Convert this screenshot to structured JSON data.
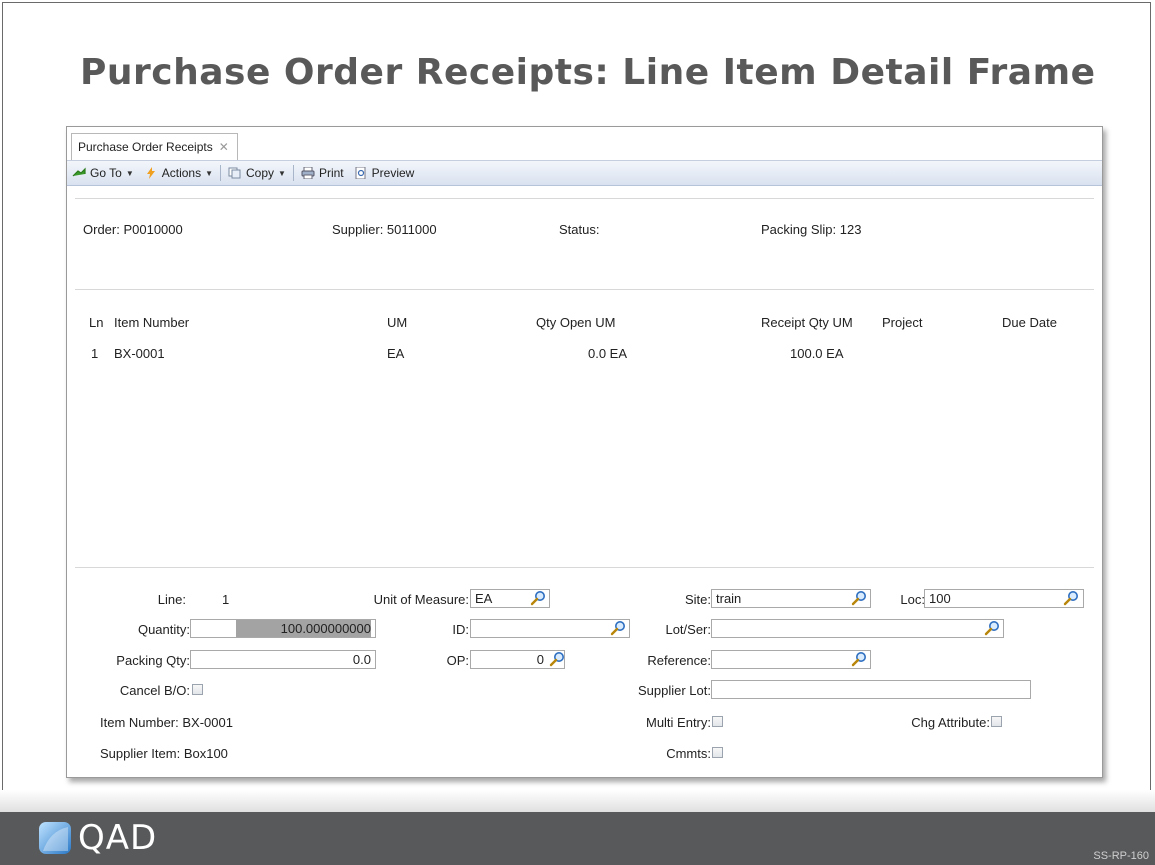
{
  "slide": {
    "title": "Purchase Order Receipts: Line Item Detail Frame",
    "code": "SS-RP-160"
  },
  "brand": {
    "name": "QAD",
    "bar_color": "#58595b"
  },
  "window": {
    "tab_label": "Purchase Order Receipts",
    "toolbar": {
      "goto": "Go To",
      "actions": "Actions",
      "copy": "Copy",
      "print": "Print",
      "preview": "Preview"
    }
  },
  "header": {
    "order": "Order: P0010000",
    "supplier": "Supplier: 5011000",
    "status": "Status:",
    "packing_slip": "Packing Slip: 123"
  },
  "lines": {
    "columns": [
      "Ln",
      "Item Number",
      "UM",
      "Qty Open UM",
      "Receipt Qty UM",
      "Project",
      "Due Date"
    ],
    "rows": [
      {
        "ln": "1",
        "item": "BX-0001",
        "um": "EA",
        "qty_open": "0.0 EA",
        "receipt_qty": "100.0 EA"
      }
    ]
  },
  "detail": {
    "line_label": "Line:",
    "line_value": "1",
    "uom_label": "Unit of Measure:",
    "uom_value": "EA",
    "site_label": "Site:",
    "site_value": "train",
    "loc_label": "Loc:",
    "loc_value": "100",
    "quantity_label": "Quantity:",
    "quantity_value": "100.000000000",
    "id_label": "ID:",
    "id_value": "",
    "lotser_label": "Lot/Ser:",
    "lotser_value": "",
    "packing_qty_label": "Packing Qty:",
    "packing_qty_value": "0.0",
    "op_label": "OP:",
    "op_value": "0",
    "reference_label": "Reference:",
    "reference_value": "",
    "cancel_bo_label": "Cancel B/O:",
    "supplier_lot_label": "Supplier Lot:",
    "supplier_lot_value": "",
    "item_number": "Item Number:  BX-0001",
    "multi_entry_label": "Multi Entry:",
    "chg_attribute_label": "Chg Attribute:",
    "supplier_item": "Supplier Item:  Box100",
    "cmmts_label": "Cmmts:"
  }
}
